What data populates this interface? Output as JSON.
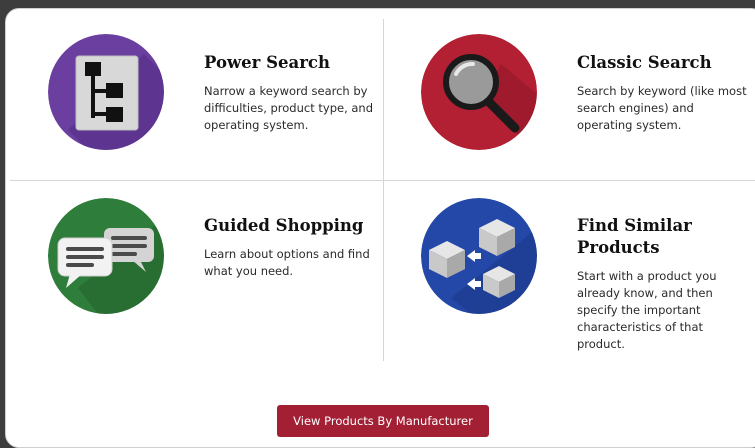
{
  "colors": {
    "power_search": "#6b3fa0",
    "classic_search": "#b31f33",
    "guided_shopping": "#2e7d3a",
    "find_similar": "#2448a8",
    "button_bg": "#a31f34"
  },
  "cards": [
    {
      "title": "Power Search",
      "description": "Narrow a keyword search by difficulties, product type, and operating system.",
      "icon": "flowchart-icon"
    },
    {
      "title": "Classic Search",
      "description": "Search by keyword (like most search engines) and operating system.",
      "icon": "magnifying-glass-icon"
    },
    {
      "title": "Guided Shopping",
      "description": "Learn about options and find what you need.",
      "icon": "chat-bubbles-icon"
    },
    {
      "title": "Find Similar Products",
      "description": "Start with a product you already know, and then specify the important characteristics of that product.",
      "icon": "boxes-icon"
    }
  ],
  "manufacturer_button": {
    "label": "View Products By Manufacturer"
  }
}
